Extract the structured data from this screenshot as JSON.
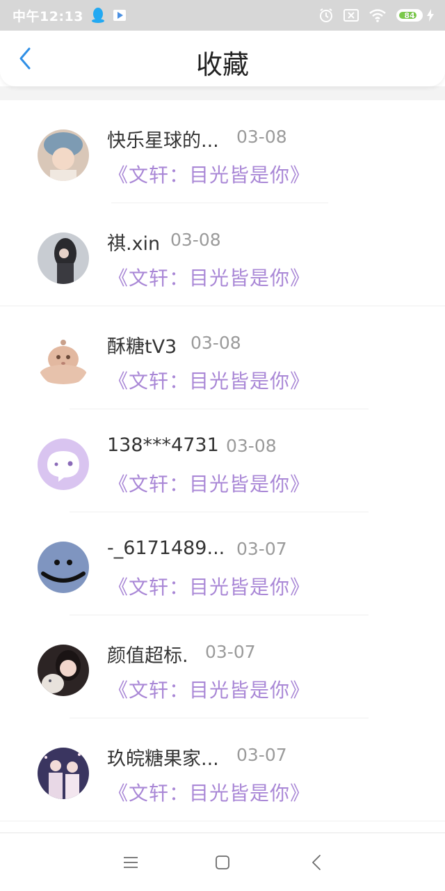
{
  "status_bar": {
    "time": "中午12:13",
    "battery": "84",
    "battery_level": 0.84,
    "icons": [
      "qq-icon",
      "play-store-icon",
      "alarm-icon",
      "sim-icon",
      "wifi-icon",
      "battery-icon",
      "charging-icon"
    ]
  },
  "header": {
    "title": "收藏",
    "back_icon": "chevron-left-icon"
  },
  "items": [
    {
      "name": "快乐星球的...",
      "date": "03-08",
      "song": "《文轩：目光皆是你》"
    },
    {
      "name": "祺.xin",
      "date": "03-08",
      "song": "《文轩：目光皆是你》"
    },
    {
      "name": "酥糖tV3",
      "date": "03-08",
      "song": "《文轩：目光皆是你》"
    },
    {
      "name": "138***4731",
      "date": "03-08",
      "song": "《文轩：目光皆是你》"
    },
    {
      "name": "-_6171489...",
      "date": "03-07",
      "song": "《文轩：目光皆是你》"
    },
    {
      "name": "颜值超标.",
      "date": "03-07",
      "song": "《文轩：目光皆是你》"
    },
    {
      "name": "玖皖糖果家...",
      "date": "03-07",
      "song": "《文轩：目光皆是你》"
    }
  ],
  "navbar": {
    "icons": [
      "menu-icon",
      "home-icon",
      "back-icon"
    ]
  },
  "colors": {
    "accent": "#2f8fe6",
    "song_text": "#a987d6",
    "date_text": "#9a9a9a",
    "name_text": "#333333"
  }
}
